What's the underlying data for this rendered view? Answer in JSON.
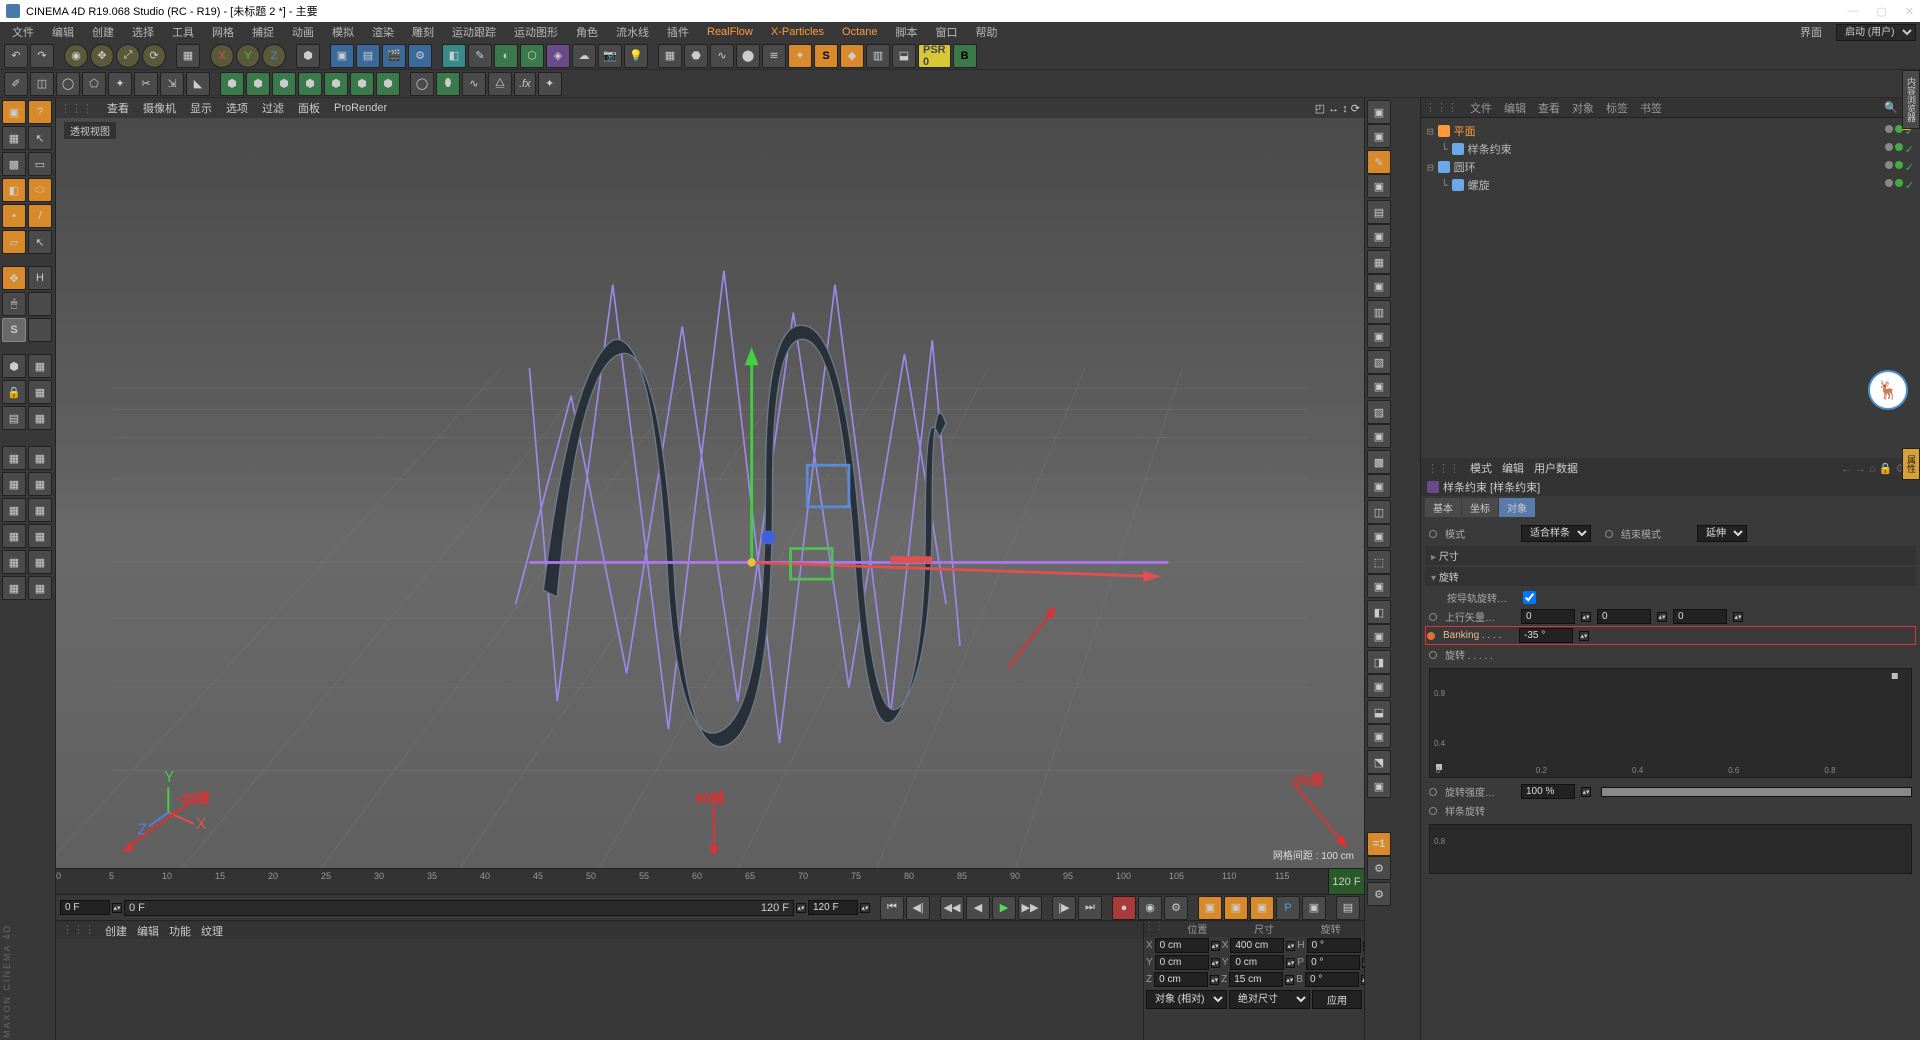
{
  "window": {
    "title": "CINEMA 4D R19.068 Studio (RC - R19) - [未标题 2 *] - 主要",
    "min": "—",
    "max": "▢",
    "close": "✕"
  },
  "menu": {
    "items": [
      "文件",
      "编辑",
      "创建",
      "选择",
      "工具",
      "网格",
      "捕捉",
      "动画",
      "模拟",
      "渲染",
      "雕刻",
      "运动跟踪",
      "运动图形",
      "角色",
      "流水线",
      "插件"
    ],
    "plugins": [
      "RealFlow",
      "X-Particles",
      "Octane",
      "脚本",
      "窗口",
      "帮助"
    ],
    "layout_label": "界面",
    "layout_value": "启动 (用户)"
  },
  "viewport": {
    "tabs": [
      "查看",
      "摄像机",
      "显示",
      "选项",
      "过滤",
      "面板",
      "ProRender"
    ],
    "label": "透视视图",
    "grid_info": "网格间距 : 100 cm"
  },
  "annotations": {
    "a1": "-35度",
    "a2": "80帧",
    "a3": "-35度"
  },
  "timeline": {
    "ticks": [
      0,
      5,
      10,
      15,
      20,
      25,
      30,
      35,
      40,
      45,
      50,
      55,
      60,
      65,
      70,
      75,
      80,
      85,
      90,
      95,
      100,
      105,
      110,
      115
    ],
    "end_label": "120 F",
    "start_field": "0 F",
    "cur_field": "0 F",
    "range_a": "120 F",
    "range_b": "120 F"
  },
  "status_tabs": [
    "创建",
    "编辑",
    "功能",
    "纹理"
  ],
  "coord": {
    "headers": [
      "位置",
      "尺寸",
      "旋转"
    ],
    "rows": [
      {
        "axis": "X",
        "pos": "0 cm",
        "size": "400 cm",
        "rot": "0 °",
        "rl": "H"
      },
      {
        "axis": "Y",
        "pos": "0 cm",
        "size": "0 cm",
        "rot": "0 °",
        "rl": "P"
      },
      {
        "axis": "Z",
        "pos": "0 cm",
        "size": "15 cm",
        "rot": "0 °",
        "rl": "B"
      }
    ],
    "footer": {
      "obj": "对象 (相对)",
      "mode": "绝对尺寸",
      "apply": "应用"
    }
  },
  "hierarchy_tabs": [
    "文件",
    "编辑",
    "查看",
    "对象",
    "标签",
    "书签"
  ],
  "hierarchy": [
    {
      "indent": 0,
      "name": "平面",
      "color": "#ff9a3c",
      "sel": true,
      "expand": "⊟"
    },
    {
      "indent": 1,
      "name": "样条约束",
      "color": "#6aa8e8",
      "sel": false,
      "expand": "└"
    },
    {
      "indent": 0,
      "name": "圆环",
      "color": "#6aa8e8",
      "sel": false,
      "expand": "⊟"
    },
    {
      "indent": 1,
      "name": "螺旋",
      "color": "#6aa8e8",
      "sel": false,
      "expand": "└"
    }
  ],
  "attr": {
    "header_tabs": [
      "模式",
      "编辑",
      "用户数据"
    ],
    "title_icon_label": "样条约束 [样条约束]",
    "tabs": [
      "基本",
      "坐标",
      "对象"
    ],
    "mode_label": "模式",
    "mode_value": "适合样条",
    "endmode_label": "结束模式",
    "endmode_value": "延伸",
    "size_section": "尺寸",
    "rotate_section": "旋转",
    "follow_label": "按导轨旋转…",
    "upvec_label": "上行矢量…",
    "upvec_vals": [
      "0",
      "0",
      "0"
    ],
    "banking_label": "Banking . . . .",
    "banking_value": "-35 °",
    "rotate_label": "旋转 . . . . .",
    "strength_label": "旋转强度…",
    "strength_value": "100 %",
    "spline_rot_label": "样条旋转",
    "graph_ticks_y": [
      "0.8",
      "0.4"
    ],
    "graph_ticks_x": [
      "0",
      "0.2",
      "0.4",
      "0.6",
      "0.8"
    ],
    "graph2_y": [
      "0.8"
    ]
  },
  "side_tabs": {
    "t1": "内容浏览器",
    "t2": "属性"
  },
  "maxon": "MAXON CINEMA 4D"
}
